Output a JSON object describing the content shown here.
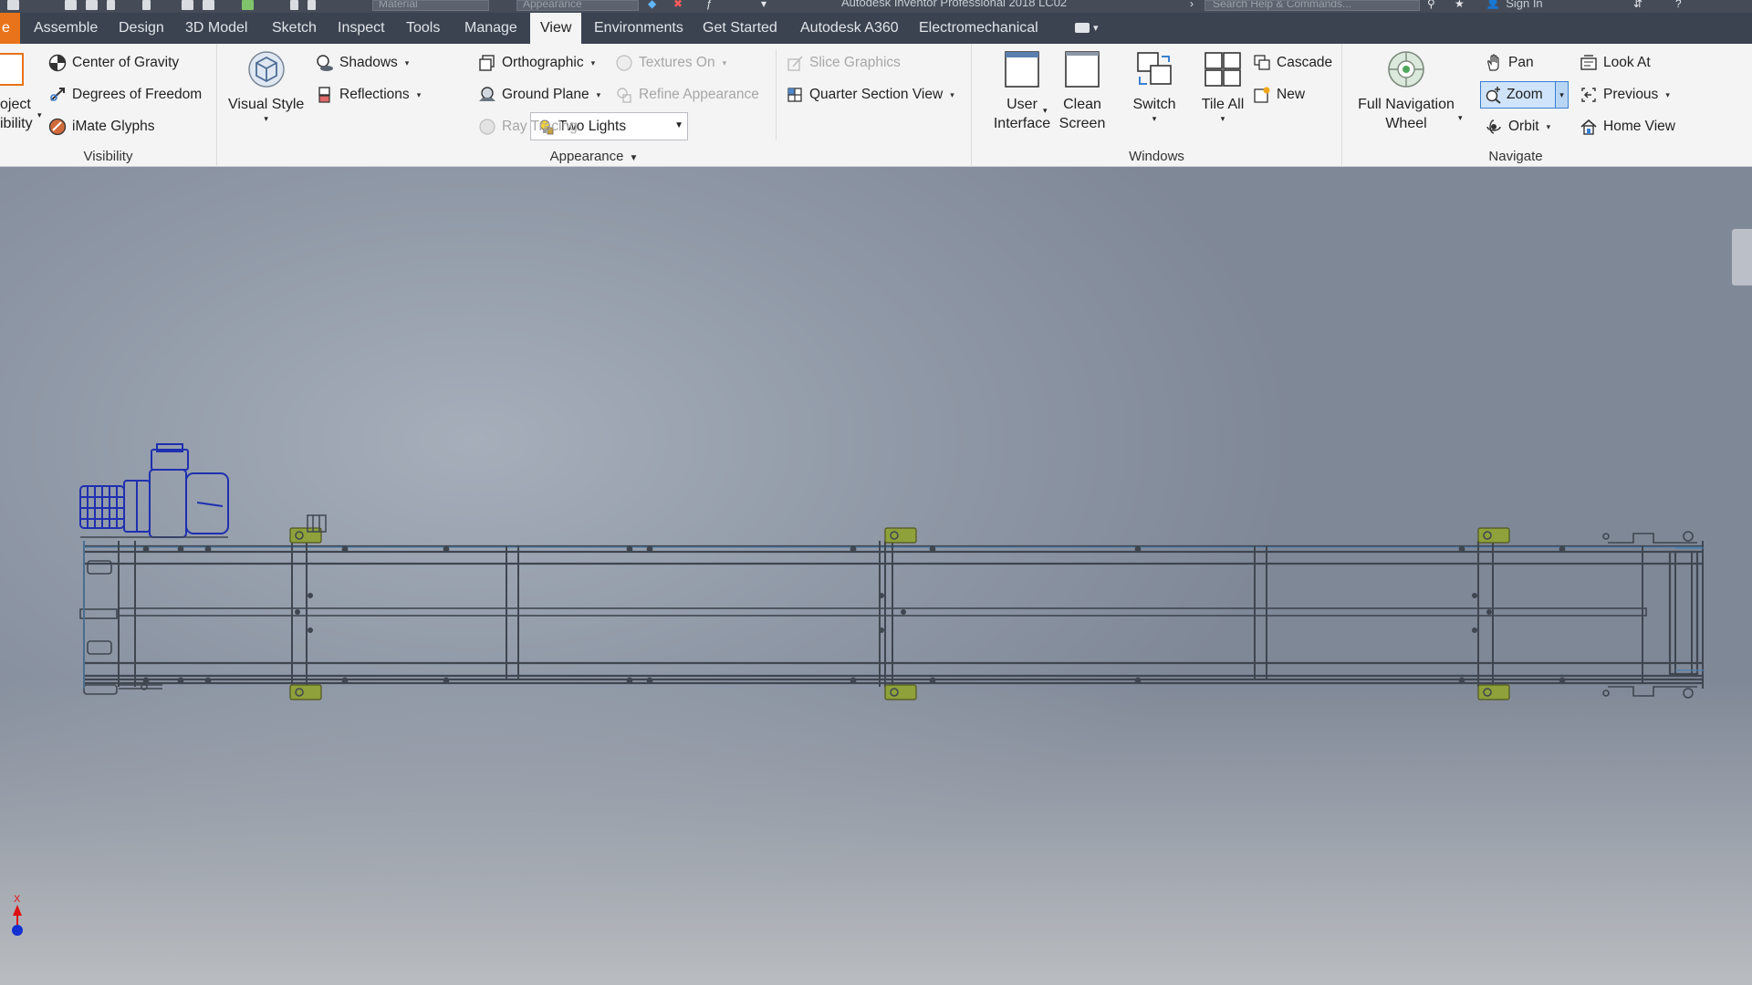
{
  "window": {
    "title": "Autodesk Inventor Professional 2018   LC02",
    "material_combo": "Material",
    "appearance_combo": "Appearance",
    "search_placeholder": "Search Help & Commands...",
    "sign_in": "Sign In"
  },
  "tabs": [
    {
      "label": "e",
      "active": false
    },
    {
      "label": "Assemble",
      "active": false
    },
    {
      "label": "Design",
      "active": false
    },
    {
      "label": "3D Model",
      "active": false
    },
    {
      "label": "Sketch",
      "active": false
    },
    {
      "label": "Inspect",
      "active": false
    },
    {
      "label": "Tools",
      "active": false
    },
    {
      "label": "Manage",
      "active": false
    },
    {
      "label": "View",
      "active": true
    },
    {
      "label": "Environments",
      "active": false
    },
    {
      "label": "Get Started",
      "active": false
    },
    {
      "label": "Autodesk A360",
      "active": false
    },
    {
      "label": "Electromechanical",
      "active": false
    }
  ],
  "ribbon": {
    "visibility": {
      "label": "Visibility",
      "object_visibility_line1": "oject",
      "object_visibility_line2": "ibility",
      "center_of_gravity": "Center of Gravity",
      "degrees_of_freedom": "Degrees of Freedom",
      "imate_glyphs": "iMate Glyphs"
    },
    "appearance": {
      "label": "Appearance",
      "visual_style": "Visual Style",
      "shadows": "Shadows",
      "reflections": "Reflections",
      "lighting": "Two Lights",
      "orthographic": "Orthographic",
      "ground_plane": "Ground Plane",
      "ray_tracing": "Ray Tracing",
      "textures_on": "Textures On",
      "refine_appearance": "Refine Appearance",
      "slice_graphics": "Slice Graphics",
      "quarter_section_view": "Quarter Section View"
    },
    "windows": {
      "label": "Windows",
      "user_interface_line1": "User",
      "user_interface_line2": "Interface",
      "clean_screen_line1": "Clean",
      "clean_screen_line2": "Screen",
      "switch": "Switch",
      "tile_all": "Tile All",
      "cascade": "Cascade",
      "new": "New"
    },
    "navigate": {
      "label": "Navigate",
      "full_nav_wheel_line1": "Full Navigation",
      "full_nav_wheel_line2": "Wheel",
      "pan": "Pan",
      "zoom": "Zoom",
      "orbit": "Orbit",
      "look_at": "Look At",
      "previous": "Previous",
      "home_view": "Home View"
    }
  },
  "triad": {
    "x_label": "X"
  },
  "colors": {
    "file_tab": "#e8731a",
    "tab_bar": "#3b4350",
    "ribbon": "#f4f4f4",
    "zoom_highlight": "#cfe3fa",
    "motor_wireframe": "#1f2fb0",
    "frame_wireframe": "#3f4650",
    "bracket_green": "#8ea13a"
  },
  "icons": [
    "object-visibility-icon",
    "center-of-gravity-icon",
    "degrees-of-freedom-icon",
    "imate-glyphs-icon",
    "visual-style-icon",
    "shadows-icon",
    "reflections-icon",
    "lighting-icon",
    "orthographic-icon",
    "ground-plane-icon",
    "ray-tracing-icon",
    "textures-icon",
    "refine-appearance-icon",
    "slice-graphics-icon",
    "quarter-section-icon",
    "user-interface-icon",
    "clean-screen-icon",
    "switch-icon",
    "tile-all-icon",
    "cascade-icon",
    "new-window-icon",
    "navigation-wheel-icon",
    "pan-icon",
    "zoom-icon",
    "orbit-icon",
    "look-at-icon",
    "previous-icon",
    "home-view-icon"
  ]
}
